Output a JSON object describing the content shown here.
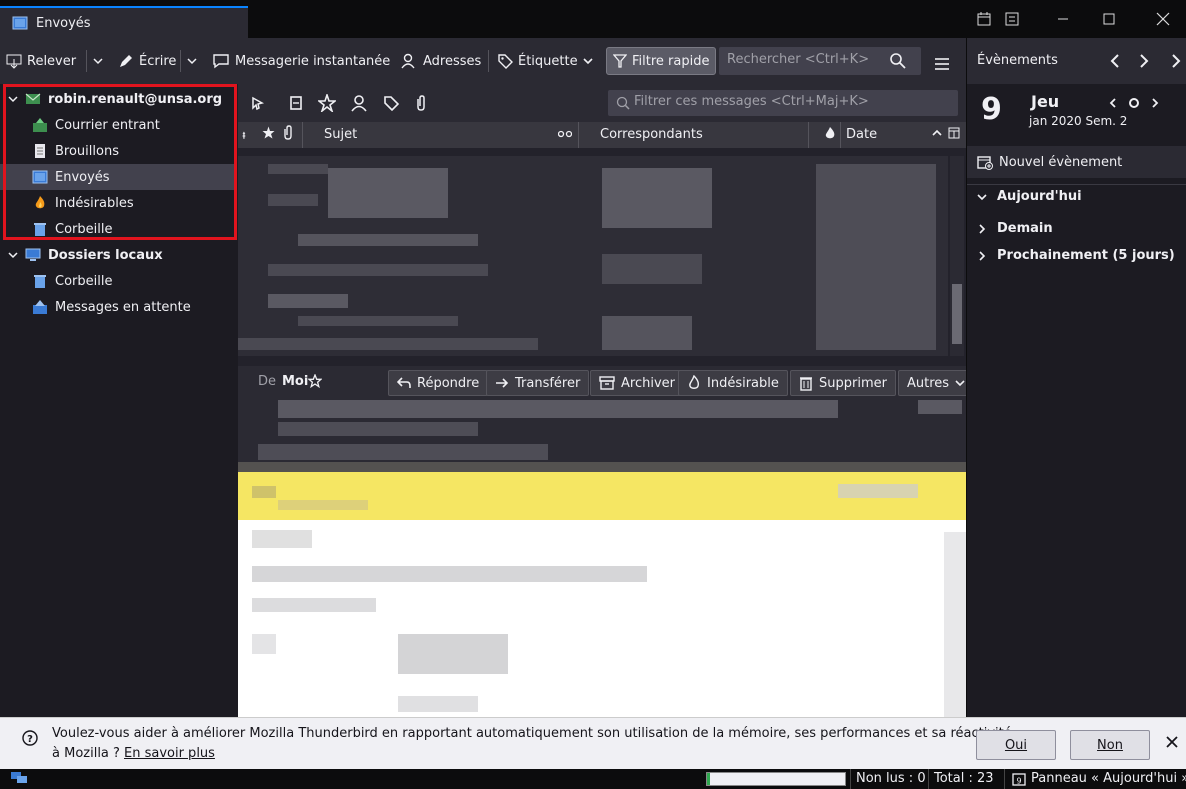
{
  "window": {
    "tab_title": "Envoyés"
  },
  "toolbar": {
    "get_mail": "Relever",
    "write": "Écrire",
    "chat": "Messagerie instantanée",
    "address_book": "Adresses",
    "tag": "Étiquette",
    "quick_filter": "Filtre rapide",
    "search_placeholder": "Rechercher <Ctrl+K>"
  },
  "folders": {
    "account": "robin.renault@unsa.org",
    "inbox": "Courrier entrant",
    "drafts": "Brouillons",
    "sent": "Envoyés",
    "junk": "Indésirables",
    "trash": "Corbeille",
    "local_folders": "Dossiers locaux",
    "local_trash": "Corbeille",
    "outbox": "Messages en attente"
  },
  "thread_pane": {
    "filter_placeholder": "Filtrer ces messages <Ctrl+Maj+K>",
    "col_subject": "Sujet",
    "col_correspondents": "Correspondants",
    "col_date": "Date"
  },
  "message_header": {
    "from_label": "De",
    "from_value": "Moi",
    "reply": "Répondre",
    "forward": "Transférer",
    "archive": "Archiver",
    "junk": "Indésirable",
    "delete": "Supprimer",
    "other": "Autres"
  },
  "today_pane": {
    "title": "Évènements",
    "day_number": "9",
    "day_name": "Jeu",
    "month_info": "jan 2020 Sem. 2",
    "new_event": "Nouvel évènement",
    "today": "Aujourd'hui",
    "tomorrow": "Demain",
    "upcoming": "Prochainement (5 jours)"
  },
  "notification": {
    "text": "Voulez-vous aider à améliorer Mozilla Thunderbird en rapportant automatiquement son utilisation de la mémoire, ses performances et sa réactivité",
    "text2": "à Mozilla ?",
    "learn_more": "En savoir plus",
    "yes": "Oui",
    "no": "Non"
  },
  "status_bar": {
    "unread": "Non lus : 0",
    "total": "Total : 23",
    "today_pane": "Panneau « Aujourd'hui »"
  },
  "colors": {
    "accent": "#0a84ff",
    "highlight_border": "#e1141e",
    "quick_filter_active": "#5b5b66",
    "yellow_bar": "#f5e663"
  }
}
